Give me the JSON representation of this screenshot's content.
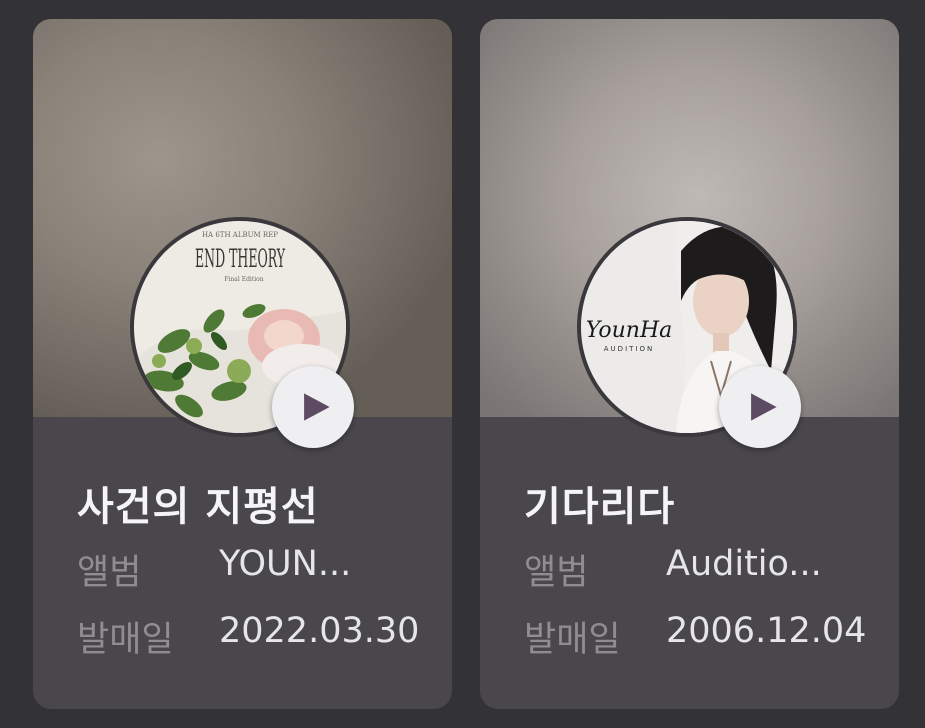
{
  "cards": [
    {
      "title": "사건의 지평선",
      "album_label": "앨범",
      "album_value": "YOUN...",
      "release_label": "발매일",
      "release_value": "2022.03.30",
      "cover": {
        "heading": "END THEORY",
        "small_top": "HA 6TH ALBUM REP",
        "small_sub": "Final Edition"
      },
      "play_icon": "play-icon"
    },
    {
      "title": "기다리다",
      "album_label": "앨범",
      "album_value": "Auditio...",
      "release_label": "발매일",
      "release_value": "2006.12.04",
      "cover": {
        "logo": "YounHa",
        "sub": "AUDITION"
      },
      "play_icon": "play-icon"
    }
  ],
  "colors": {
    "background": "#333236",
    "card": "#49474c",
    "play_triangle": "#5d4a63"
  }
}
